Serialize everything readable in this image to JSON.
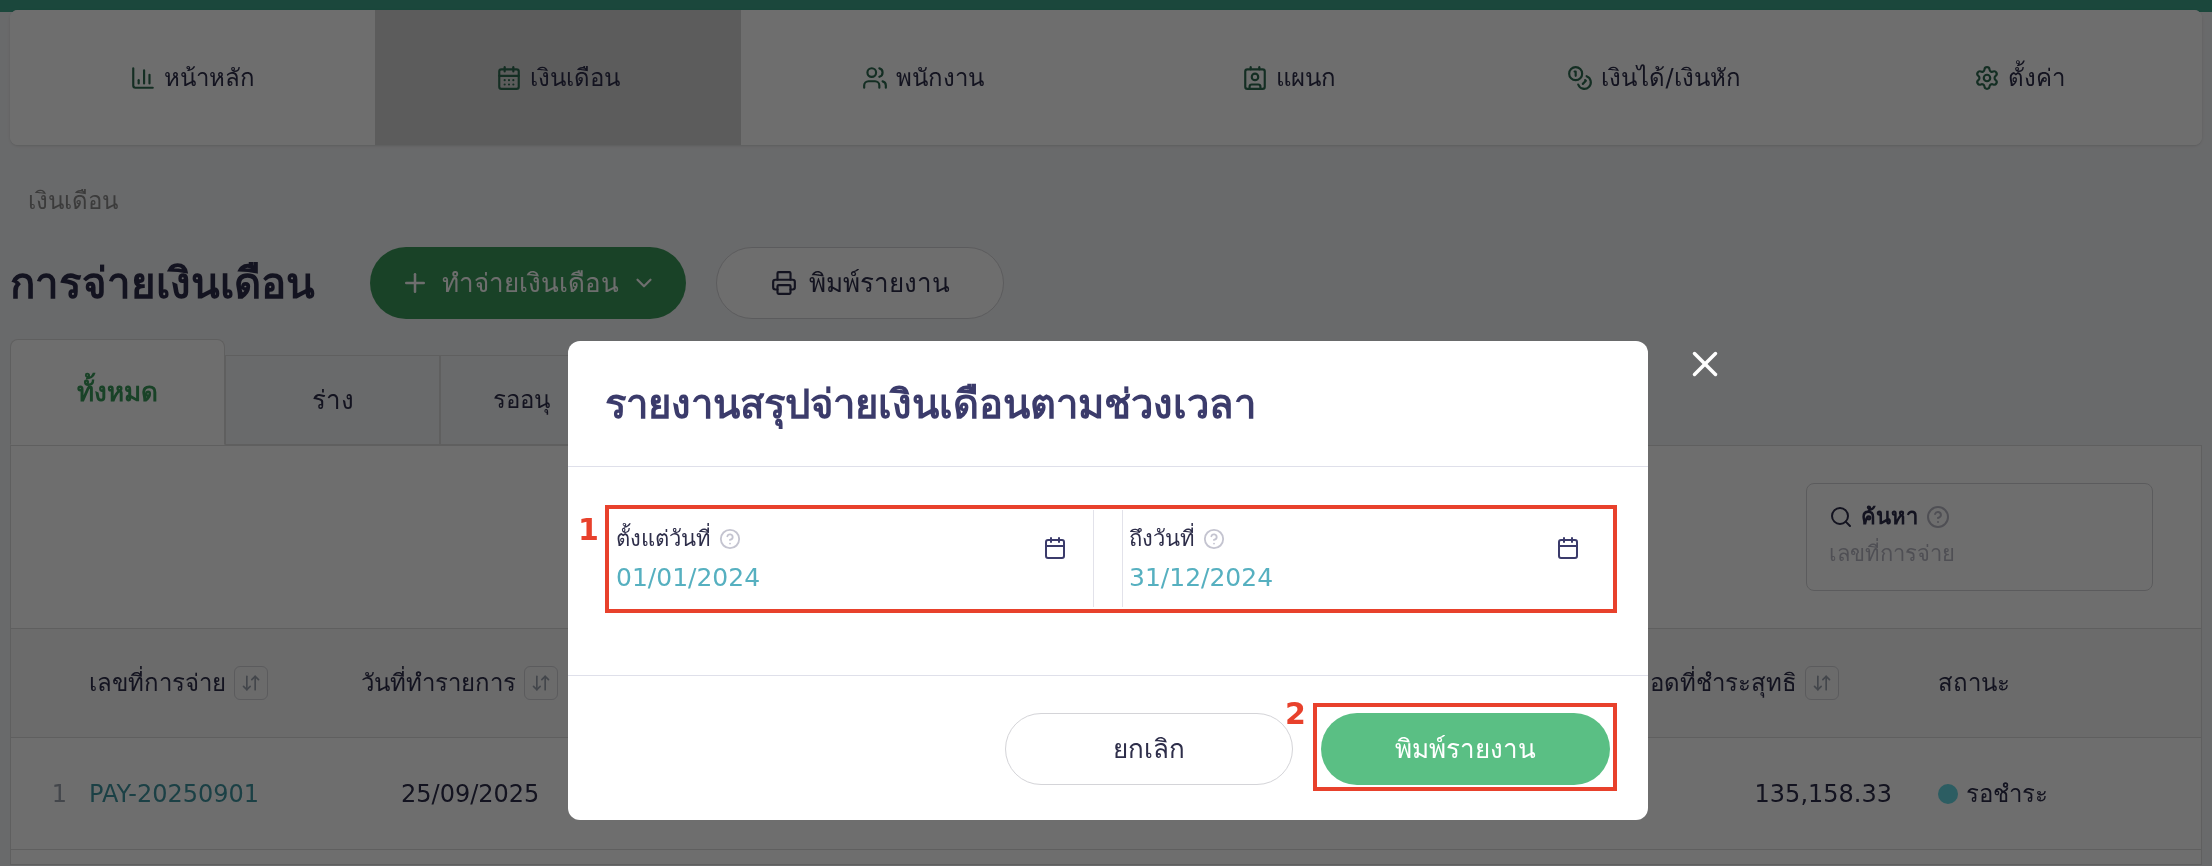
{
  "nav": {
    "items": [
      {
        "label": "หน้าหลัก",
        "selected": false
      },
      {
        "label": "เงินเดือน",
        "selected": true
      },
      {
        "label": "พนักงาน",
        "selected": false
      },
      {
        "label": "แผนก",
        "selected": false
      },
      {
        "label": "เงินได้/เงินหัก",
        "selected": false
      },
      {
        "label": "ตั้งค่า",
        "selected": false
      }
    ]
  },
  "breadcrumb": "เงินเดือน",
  "page_title": "การจ่ายเงินเดือน",
  "actions": {
    "create": "ทำจ่ายเงินเดือน",
    "print": "พิมพ์รายงาน"
  },
  "status_tabs": [
    {
      "label": "ทั้งหมด",
      "selected": true
    },
    {
      "label": "ร่าง",
      "selected": false
    },
    {
      "label": "รออนุ",
      "selected": false
    }
  ],
  "search": {
    "label": "ค้นหา",
    "placeholder": "เลขที่การจ่าย"
  },
  "table": {
    "columns": [
      {
        "label": "เลขที่การจ่าย",
        "sortable": true
      },
      {
        "label": "วันที่ทำรายการ",
        "sortable": true
      },
      {
        "label": "อดที่ชำระสุทธิ",
        "sortable": true
      },
      {
        "label": "สถานะ",
        "sortable": false
      }
    ],
    "rows": [
      {
        "index": "1",
        "pay_no": "PAY-20250901",
        "date": "25/09/2025",
        "net": "135,158.33",
        "status": {
          "label": "รอชำระ",
          "color": "#2c5d62"
        }
      }
    ]
  },
  "modal": {
    "title": "รายงานสรุปจ่ายเงินเดือนตามช่วงเวลา",
    "fields": [
      {
        "label": "ตั้งแต่วันที่",
        "value": "01/01/2024"
      },
      {
        "label": "ถึงวันที่",
        "value": "31/12/2024"
      }
    ],
    "cancel": "ยกเลิก",
    "submit": "พิมพ์รายงาน",
    "annotations": [
      {
        "label": "1"
      },
      {
        "label": "2"
      }
    ]
  }
}
